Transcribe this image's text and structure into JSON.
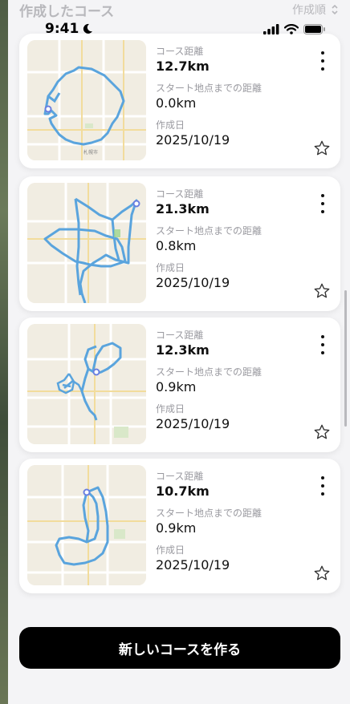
{
  "header": {
    "title": "作成したコース",
    "sort_label": "作成順",
    "sort_icon": "chevron-up-down-icon"
  },
  "status_bar": {
    "time": "9:41",
    "icons": [
      "moon-icon",
      "signal-icon",
      "wifi-icon",
      "battery-icon"
    ]
  },
  "labels": {
    "distance": "コース距離",
    "start_distance": "スタート地点までの距離",
    "created": "作成日"
  },
  "courses": [
    {
      "distance": "12.7km",
      "start_distance": "0.0km",
      "created": "2025/10/19"
    },
    {
      "distance": "21.3km",
      "start_distance": "0.8km",
      "created": "2025/10/19"
    },
    {
      "distance": "12.3km",
      "start_distance": "0.9km",
      "created": "2025/10/19"
    },
    {
      "distance": "10.7km",
      "start_distance": "0.9km",
      "created": "2025/10/19"
    }
  ],
  "map_label": "札幌市",
  "new_course_button": "新しいコースを作る",
  "colors": {
    "route": "#5aa4dd",
    "map_bg": "#f1ede2",
    "primary_button": "#000000"
  }
}
